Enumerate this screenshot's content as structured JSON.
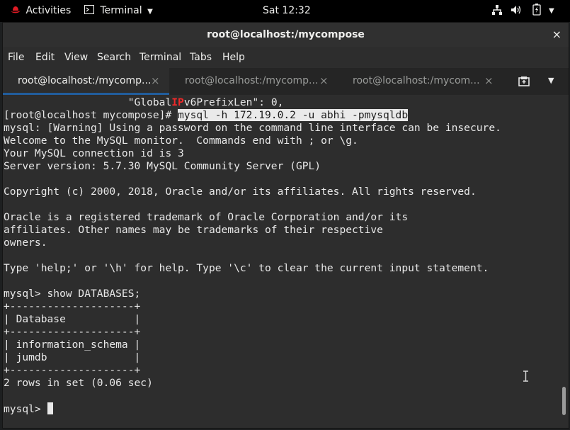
{
  "topbar": {
    "activities": "Activities",
    "app_menu": "Terminal",
    "clock": "Sat 12:32"
  },
  "window": {
    "title": "root@localhost:/mycompose",
    "close": "×"
  },
  "menu": [
    "File",
    "Edit",
    "View",
    "Search",
    "Terminal",
    "Tabs",
    "Help"
  ],
  "tabs": [
    {
      "label": "root@localhost:/mycomp...",
      "active": true
    },
    {
      "label": "root@localhost:/mycomp...",
      "active": false
    },
    {
      "label": "root@localhost:/mycom...",
      "active": false
    }
  ],
  "tab_close": "×",
  "terminal": {
    "partial_line_prefix": "                    \"Global",
    "partial_line_highlight": "IP",
    "partial_line_suffix": "v6PrefixLen\": 0,",
    "prompt": "[root@localhost mycompose]# ",
    "command": "mysql -h 172.19.0.2 -u abhi -pmysqldb",
    "lines": [
      "mysql: [Warning] Using a password on the command line interface can be insecure.",
      "Welcome to the MySQL monitor.  Commands end with ; or \\g.",
      "Your MySQL connection id is 3",
      "Server version: 5.7.30 MySQL Community Server (GPL)",
      "",
      "Copyright (c) 2000, 2018, Oracle and/or its affiliates. All rights reserved.",
      "",
      "Oracle is a registered trademark of Oracle Corporation and/or its",
      "affiliates. Other names may be trademarks of their respective",
      "owners.",
      "",
      "Type 'help;' or '\\h' for help. Type '\\c' to clear the current input statement.",
      "",
      "mysql> show DATABASES;",
      "+--------------------+",
      "| Database           |",
      "+--------------------+",
      "| information_schema |",
      "| jumdb              |",
      "+--------------------+",
      "2 rows in set (0.06 sec)",
      ""
    ],
    "final_prompt": "mysql> "
  }
}
